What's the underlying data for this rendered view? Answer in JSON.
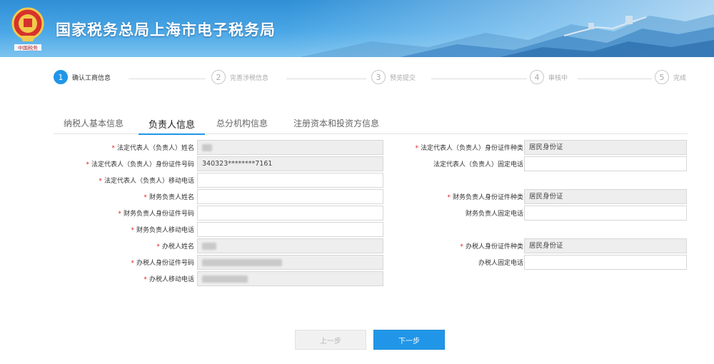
{
  "header": {
    "title": "国家税务总局上海市电子税务局",
    "emblem_text": "中国税务"
  },
  "steps": [
    {
      "num": "1",
      "label": "确认工商信息",
      "active": true
    },
    {
      "num": "2",
      "label": "完善涉税信息",
      "active": false
    },
    {
      "num": "3",
      "label": "预览提交",
      "active": false
    },
    {
      "num": "4",
      "label": "审核中",
      "active": false
    },
    {
      "num": "5",
      "label": "完成",
      "active": false
    }
  ],
  "tabs": [
    "纳税人基本信息",
    "负责人信息",
    "总分机构信息",
    "注册资本和投资方信息"
  ],
  "active_tab": "负责人信息",
  "form": {
    "left": [
      {
        "label": "法定代表人（负责人）姓名",
        "required": true,
        "value": "",
        "readonly": true,
        "masked": true
      },
      {
        "label": "法定代表人（负责人）身份证件号码",
        "required": true,
        "value": "340323********7161",
        "readonly": true,
        "masked": false
      },
      {
        "label": "法定代表人（负责人）移动电话",
        "required": true,
        "value": "",
        "readonly": false,
        "masked": false
      },
      {
        "label": "财务负责人姓名",
        "required": true,
        "value": "",
        "readonly": false,
        "masked": false
      },
      {
        "label": "财务负责人身份证件号码",
        "required": true,
        "value": "",
        "readonly": false,
        "masked": false
      },
      {
        "label": "财务负责人移动电话",
        "required": true,
        "value": "",
        "readonly": false,
        "masked": false
      },
      {
        "label": "办税人姓名",
        "required": true,
        "value": "",
        "readonly": true,
        "masked": true
      },
      {
        "label": "办税人身份证件号码",
        "required": true,
        "value": "",
        "readonly": true,
        "masked": true
      },
      {
        "label": "办税人移动电话",
        "required": true,
        "value": "",
        "readonly": true,
        "masked": true
      }
    ],
    "right": [
      {
        "label": "法定代表人（负责人）身份证件种类",
        "required": true,
        "value": "居民身份证",
        "readonly": true
      },
      {
        "label": "法定代表人（负责人）固定电话",
        "required": false,
        "value": "",
        "readonly": false
      },
      {
        "label": "财务负责人身份证件种类",
        "required": true,
        "value": "居民身份证",
        "readonly": true
      },
      {
        "label": "财务负责人固定电话",
        "required": false,
        "value": "",
        "readonly": false
      },
      {
        "label": "办税人身份证件种类",
        "required": true,
        "value": "居民身份证",
        "readonly": true
      },
      {
        "label": "办税人固定电话",
        "required": false,
        "value": "",
        "readonly": false
      }
    ]
  },
  "buttons": {
    "prev_label": "上一步",
    "next_label": "下一步"
  },
  "colors": {
    "accent": "#2196e8",
    "required_mark": "#e02020",
    "banner": "#3d9be0"
  }
}
